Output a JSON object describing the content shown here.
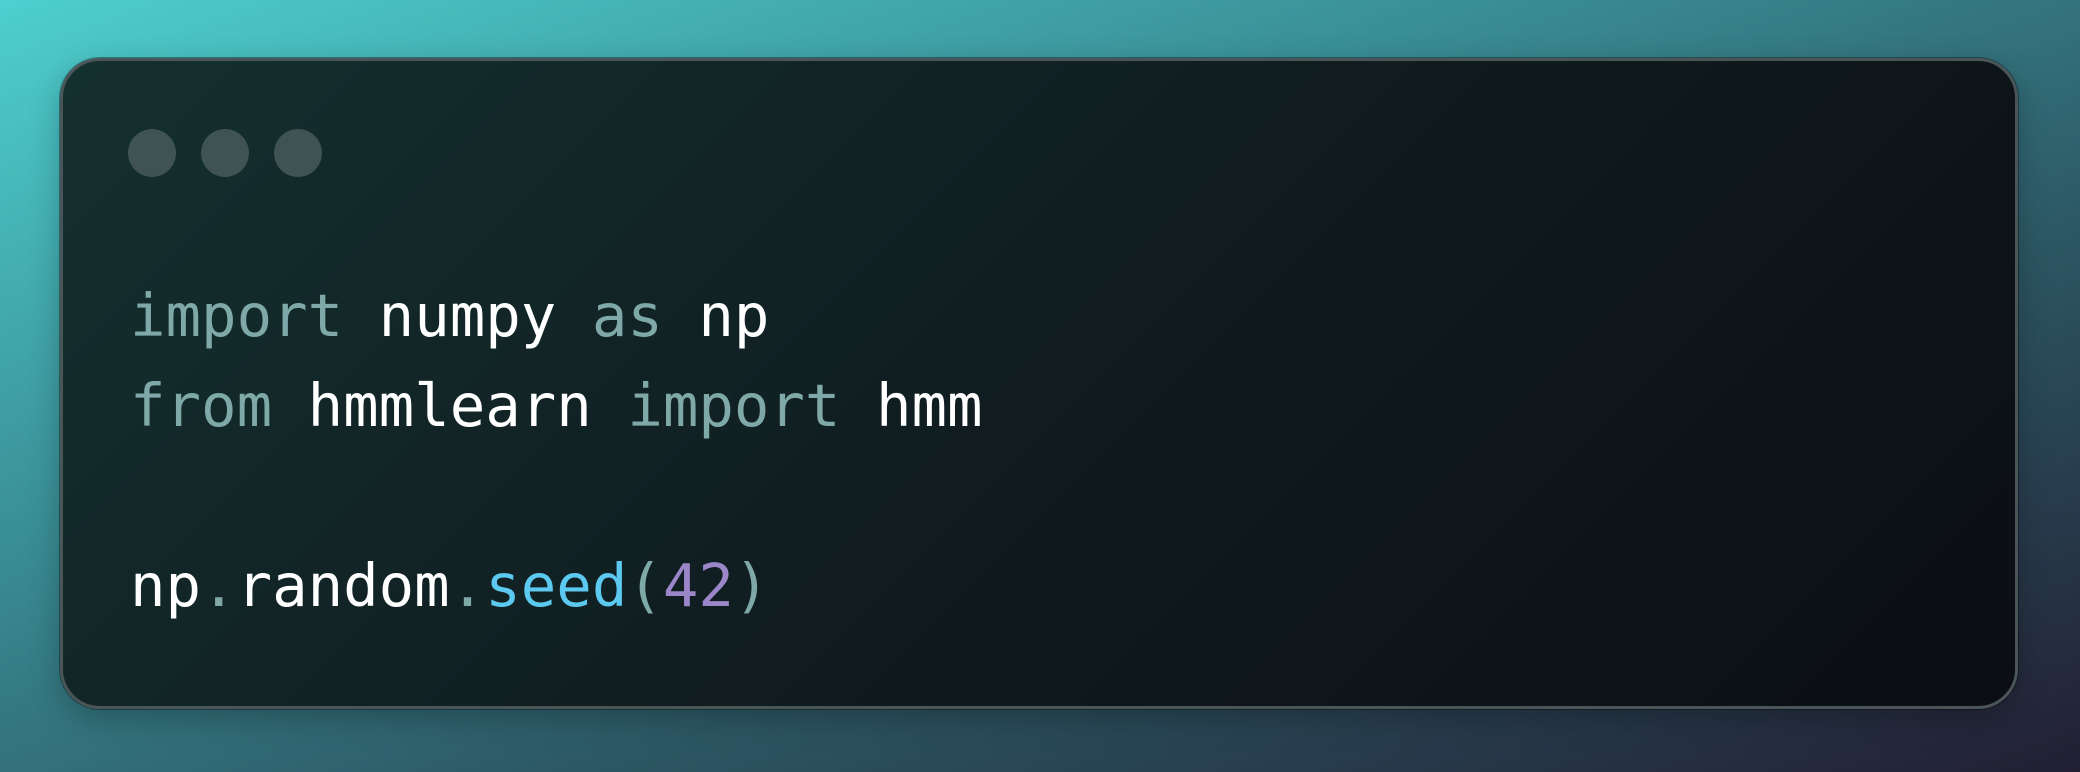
{
  "window": {
    "controls": [
      "window-dot",
      "window-dot",
      "window-dot"
    ]
  },
  "code": {
    "lines": [
      [
        {
          "text": "import",
          "kind": "keyword"
        },
        {
          "text": " ",
          "kind": "space"
        },
        {
          "text": "numpy",
          "kind": "identifier"
        },
        {
          "text": " ",
          "kind": "space"
        },
        {
          "text": "as",
          "kind": "keyword"
        },
        {
          "text": " ",
          "kind": "space"
        },
        {
          "text": "np",
          "kind": "identifier"
        }
      ],
      [
        {
          "text": "from",
          "kind": "keyword"
        },
        {
          "text": " ",
          "kind": "space"
        },
        {
          "text": "hmmlearn",
          "kind": "identifier"
        },
        {
          "text": " ",
          "kind": "space"
        },
        {
          "text": "import",
          "kind": "keyword"
        },
        {
          "text": " ",
          "kind": "space"
        },
        {
          "text": "hmm",
          "kind": "identifier"
        }
      ],
      [],
      [
        {
          "text": "np",
          "kind": "identifier"
        },
        {
          "text": ".",
          "kind": "punctuation"
        },
        {
          "text": "random",
          "kind": "identifier"
        },
        {
          "text": ".",
          "kind": "punctuation"
        },
        {
          "text": "seed",
          "kind": "function"
        },
        {
          "text": "(",
          "kind": "punctuation"
        },
        {
          "text": "42",
          "kind": "number"
        },
        {
          "text": ")",
          "kind": "punctuation"
        }
      ]
    ]
  },
  "colors": {
    "keyword": "#7fa8a8",
    "identifier": "#ffffff",
    "punctuation": "#7fa8a8",
    "function": "#5ccaf0",
    "number": "#9a86c8",
    "window_dot": "#3f5353"
  }
}
